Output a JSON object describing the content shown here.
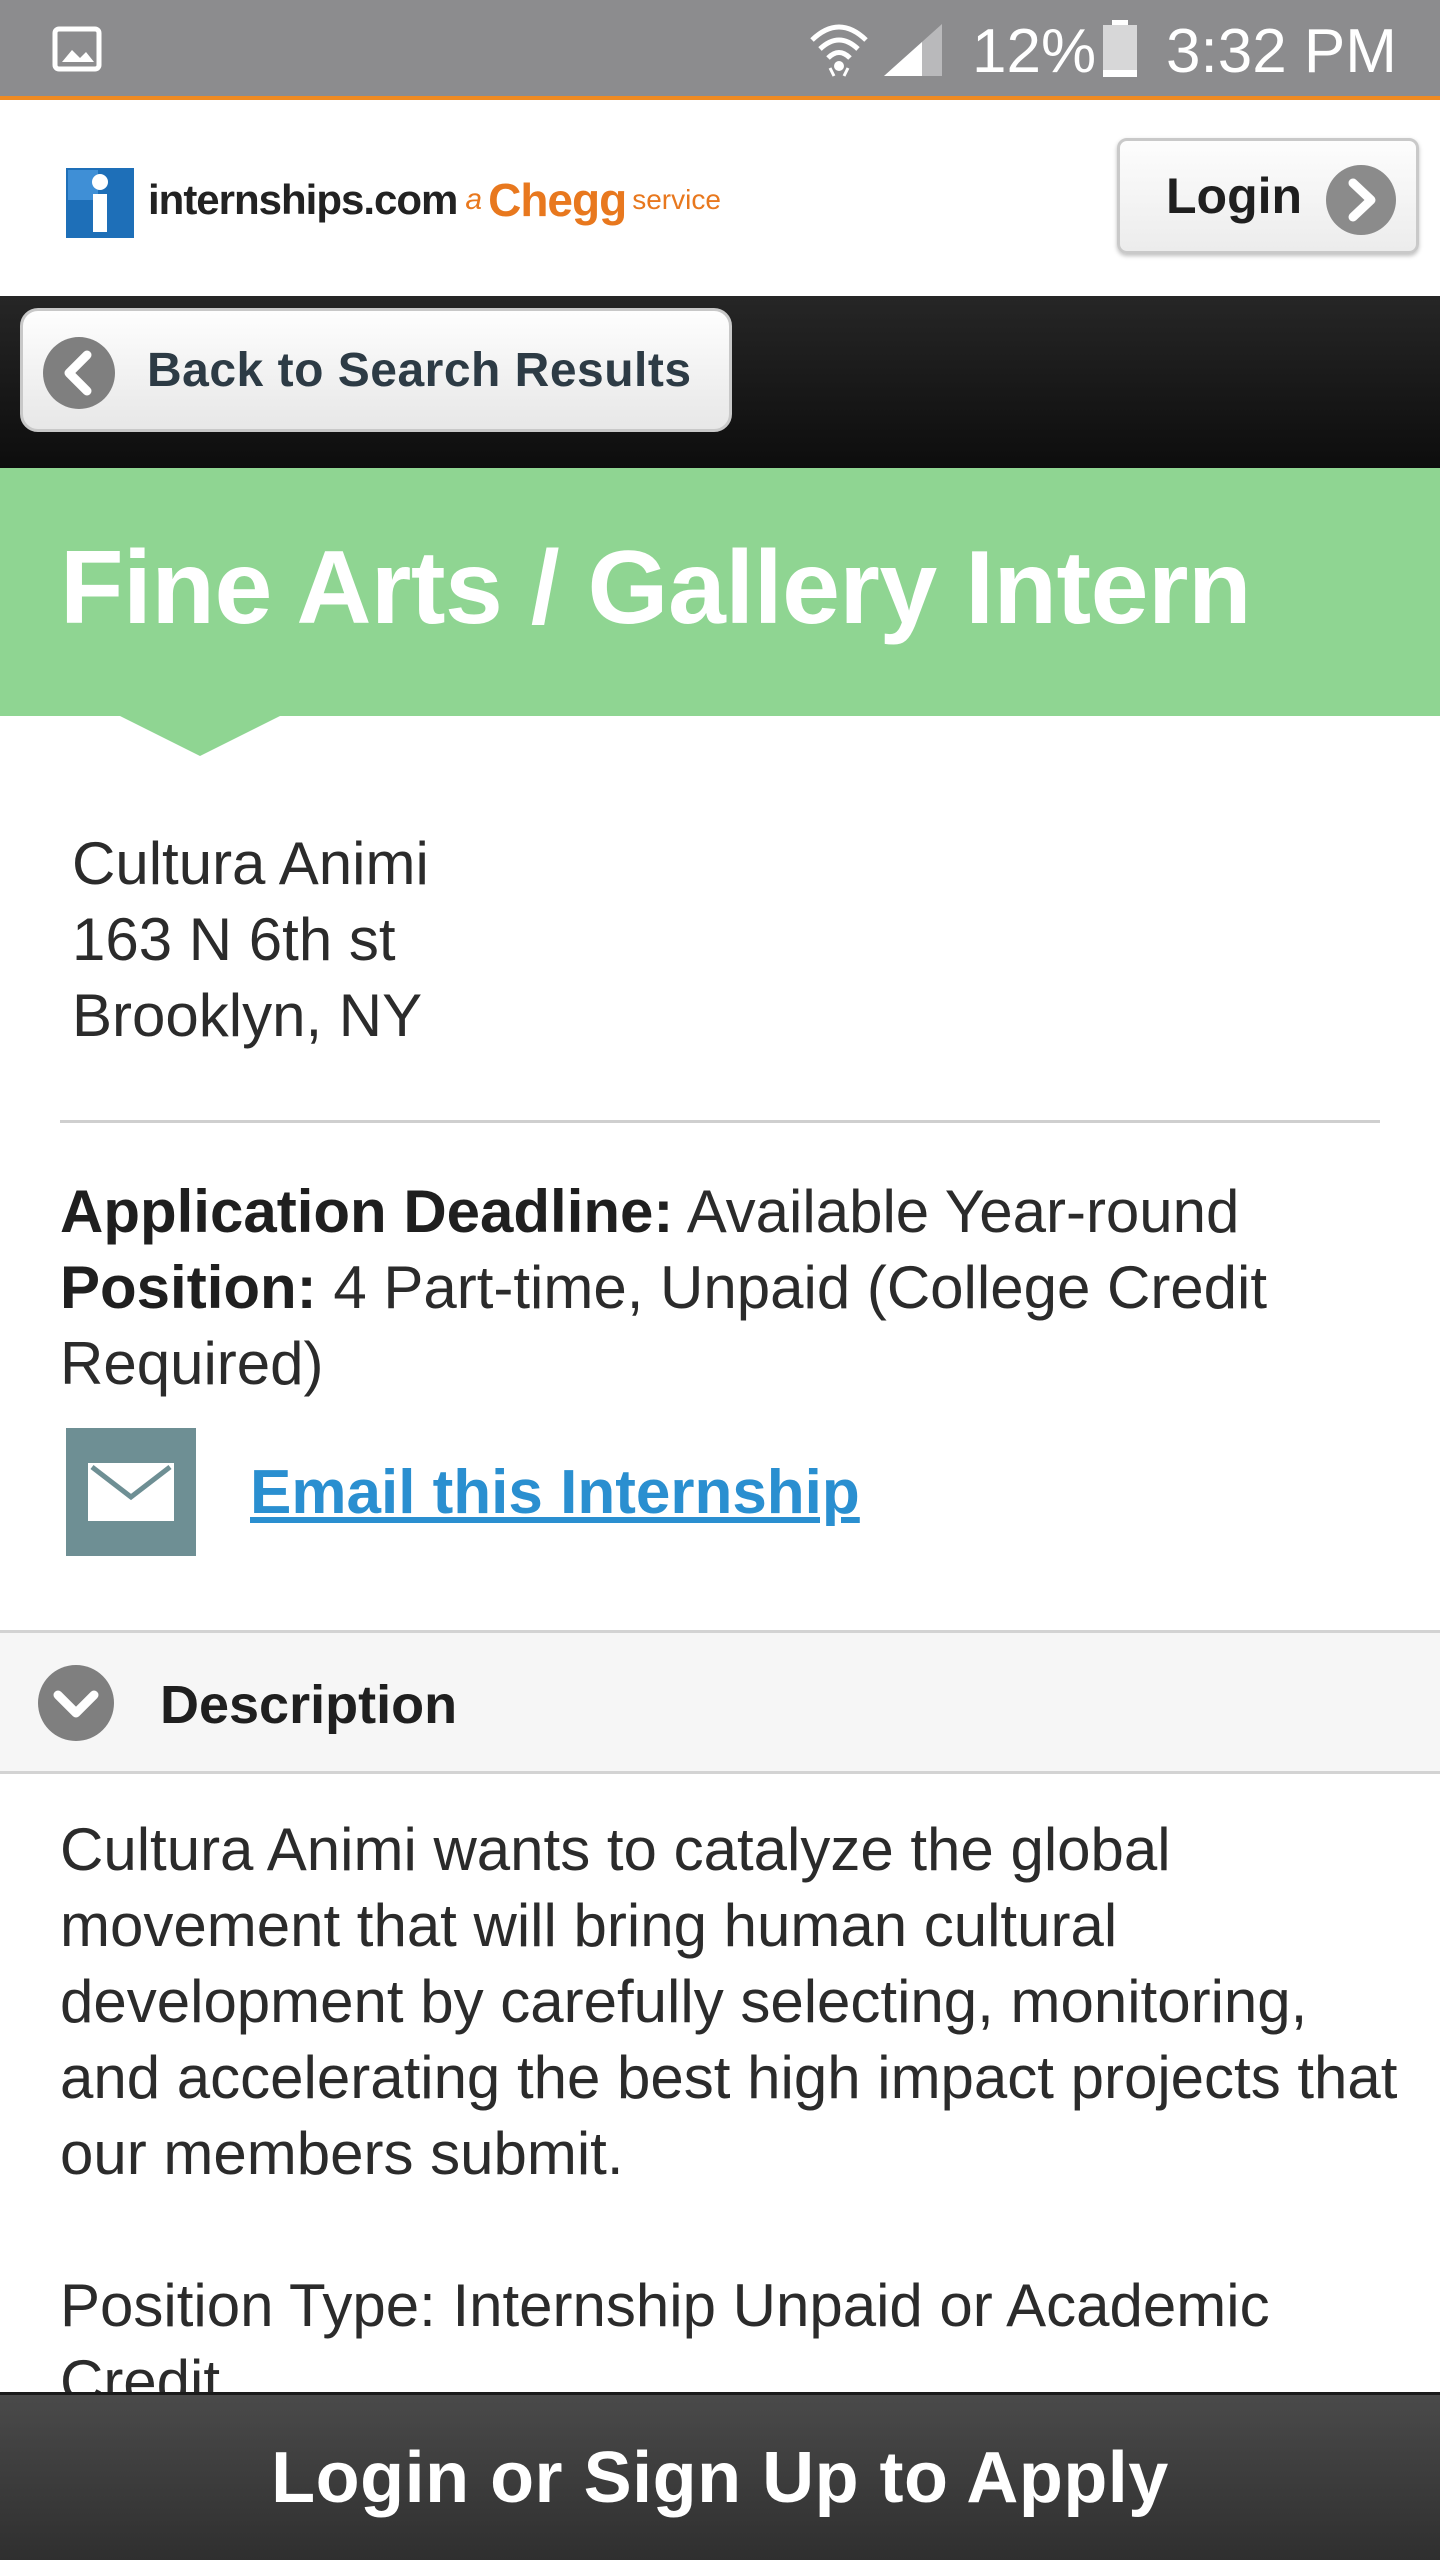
{
  "status_bar": {
    "battery_percent": "12%",
    "time": "3:32 PM",
    "icons": [
      "image-icon",
      "wifi-icon",
      "signal-icon",
      "battery-icon"
    ]
  },
  "header": {
    "logo": {
      "name": "internships.com",
      "tagline_a": "a",
      "brand": "Chegg",
      "service": "service"
    },
    "login_label": "Login"
  },
  "nav": {
    "back_label": "Back to Search Results"
  },
  "listing": {
    "title": "Fine Arts / Gallery Intern",
    "company": "Cultura Animi",
    "street": "163 N 6th st",
    "city": "Brooklyn, NY",
    "deadline_label": "Application Deadline:",
    "deadline_value": "Available Year-round",
    "position_label": "Position:",
    "position_value": "4 Part-time, Unpaid (College Credit Required)",
    "email_label": "Email this Internship"
  },
  "description": {
    "header": "Description",
    "paragraph_1": "Cultura Animi wants to catalyze the global movement that will bring human cultural development by carefully selecting, monitoring, and accelerating the best high impact projects that our members submit.",
    "paragraph_2": "Position Type: Internship Unpaid or Academic Credit"
  },
  "apply_bar": {
    "label": "Login or Sign Up to Apply"
  },
  "colors": {
    "status_bar": "#8c8c8e",
    "status_accent": "#ef8a21",
    "title_band": "#8fd592",
    "link": "#2a8fd0",
    "email_icon_bg": "#6e8f94",
    "brand_orange": "#e8781e"
  }
}
